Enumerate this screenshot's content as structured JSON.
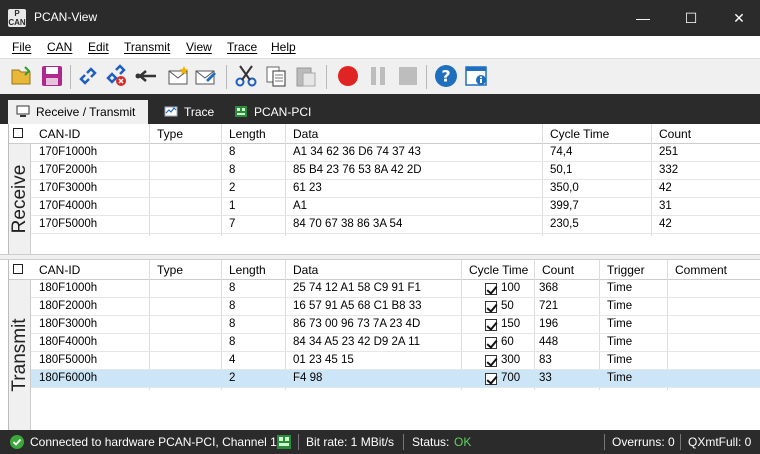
{
  "window": {
    "title": "PCAN-View",
    "minimize": "—",
    "maximize": "☐",
    "close": "✕"
  },
  "menu": [
    "File",
    "CAN",
    "Edit",
    "Transmit",
    "View",
    "Trace",
    "Help"
  ],
  "tabs": [
    {
      "label": "Receive / Transmit",
      "icon": "receive-transmit-icon"
    },
    {
      "label": "Trace",
      "icon": "trace-icon"
    },
    {
      "label": "PCAN-PCI",
      "icon": "hardware-icon"
    }
  ],
  "receive": {
    "side_label": "Receive",
    "columns": [
      "CAN-ID",
      "Type",
      "Length",
      "Data",
      "Cycle Time",
      "Count"
    ],
    "rows": [
      {
        "id": "170F1000h",
        "type": "",
        "length": "8",
        "data": "A1 34 62 36 D6 74 37 43",
        "cycle": "74,4",
        "count": "251"
      },
      {
        "id": "170F2000h",
        "type": "",
        "length": "8",
        "data": "85 B4 23 76 53 8A 42 2D",
        "cycle": "50,1",
        "count": "332"
      },
      {
        "id": "170F3000h",
        "type": "",
        "length": "2",
        "data": "61 23",
        "cycle": "350,0",
        "count": "42"
      },
      {
        "id": "170F4000h",
        "type": "",
        "length": "1",
        "data": "A1",
        "cycle": "399,7",
        "count": "31"
      },
      {
        "id": "170F5000h",
        "type": "",
        "length": "7",
        "data": "84 70 67 38 86 3A 54",
        "cycle": "230,5",
        "count": "42"
      }
    ]
  },
  "transmit": {
    "side_label": "Transmit",
    "columns": [
      "CAN-ID",
      "Type",
      "Length",
      "Data",
      "Cycle Time",
      "Count",
      "Trigger",
      "Comment"
    ],
    "rows": [
      {
        "id": "180F1000h",
        "type": "",
        "length": "8",
        "data": "25 74 12 A1 58 C9 91 F1",
        "cycle": "100",
        "count": "368",
        "trigger": "Time",
        "comment": "",
        "checked": true
      },
      {
        "id": "180F2000h",
        "type": "",
        "length": "8",
        "data": "16 57 91 A5 68 C1 B8 33",
        "cycle": "50",
        "count": "721",
        "trigger": "Time",
        "comment": "",
        "checked": true
      },
      {
        "id": "180F3000h",
        "type": "",
        "length": "8",
        "data": "86 73 00 96 73 7A 23 4D",
        "cycle": "150",
        "count": "196",
        "trigger": "Time",
        "comment": "",
        "checked": true
      },
      {
        "id": "180F4000h",
        "type": "",
        "length": "8",
        "data": "84 34 A5 23 42 D9 2A 11",
        "cycle": "60",
        "count": "448",
        "trigger": "Time",
        "comment": "",
        "checked": true
      },
      {
        "id": "180F5000h",
        "type": "",
        "length": "4",
        "data": "01 23 45 15",
        "cycle": "300",
        "count": "83",
        "trigger": "Time",
        "comment": "",
        "checked": true
      },
      {
        "id": "180F6000h",
        "type": "",
        "length": "2",
        "data": "F4 98",
        "cycle": "700",
        "count": "33",
        "trigger": "Time",
        "comment": "",
        "checked": true
      }
    ]
  },
  "status": {
    "connection": "Connected to hardware PCAN-PCI, Channel 1",
    "bitrate": "Bit rate: 1 MBit/s",
    "status_label": "Status:",
    "status_value": "OK",
    "overruns": "Overruns: 0",
    "qxmtfull": "QXmtFull: 0"
  },
  "colors": {
    "titlebar": "#2b2b2b",
    "selected_row": "#cde6f7",
    "status_ok": "#5fd35f",
    "record": "#e02424",
    "help": "#1f6fbf"
  }
}
